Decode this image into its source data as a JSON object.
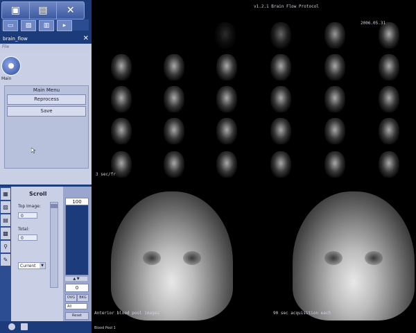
{
  "panel": {
    "title": "brain_flow",
    "close": "✕",
    "file_menu": "File",
    "main_label": "Main",
    "menu_title": "Main Menu",
    "reprocess_label": "Reprocess",
    "save_label": "Save"
  },
  "scroll": {
    "title": "Scroll",
    "top_image_label": "Top Image:",
    "top_image_value": "0",
    "total_label": "Total:",
    "total_value": "0",
    "mode_value": "Current",
    "upper_value": "100",
    "lower_value": "0",
    "ovg_label": "OVG",
    "bkg_label": "BKG",
    "all_value": "All",
    "reset_label": "Reset"
  },
  "viewer": {
    "protocol": "v1.2.1 Brain Flow Protocol",
    "date": "2006.05.31",
    "timing": "3 sec/fr",
    "left_caption": "Anterior blood pool images",
    "right_caption": "90 sec acquisition each",
    "footer": "Blood Pool 1"
  },
  "colors": {
    "panel_bg": "#c9d0e6",
    "frame_blue": "#1c3b7a",
    "viewer_bg": "#000000"
  }
}
